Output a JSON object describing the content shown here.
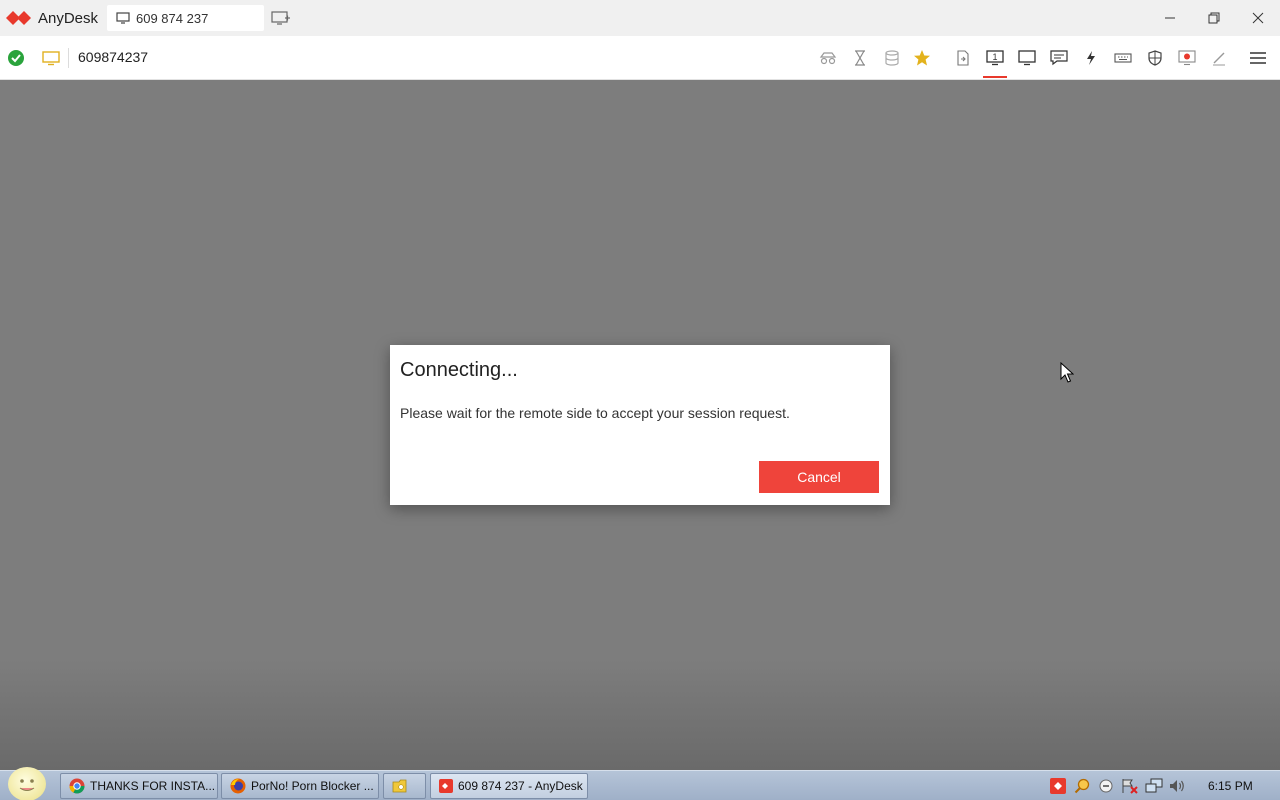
{
  "app": {
    "name": "AnyDesk",
    "tab_label": "609 874 237",
    "address_value": "609874237",
    "accent_color": "#ef443b"
  },
  "toolbar": {
    "icons": [
      "privacy-icon",
      "hourglass-icon",
      "database-icon",
      "star-icon",
      "file-transfer-icon",
      "display-1-icon",
      "monitor-icon",
      "chat-icon",
      "actions-icon",
      "keyboard-icon",
      "permissions-icon",
      "record-icon",
      "whiteboard-icon",
      "menu-icon"
    ]
  },
  "dialog": {
    "title": "Connecting...",
    "message": "Please wait for the remote side to accept your session request.",
    "cancel_label": "Cancel"
  },
  "taskbar": {
    "tasks": [
      {
        "label": "THANKS FOR INSTA...",
        "icon": "chrome-icon"
      },
      {
        "label": "PorNo! Porn Blocker ...",
        "icon": "firefox-icon"
      },
      {
        "label": "",
        "icon": "folder-icon"
      },
      {
        "label": "609 874 237 - AnyDesk",
        "icon": "anydesk-icon"
      }
    ],
    "clock": "6:15 PM"
  }
}
